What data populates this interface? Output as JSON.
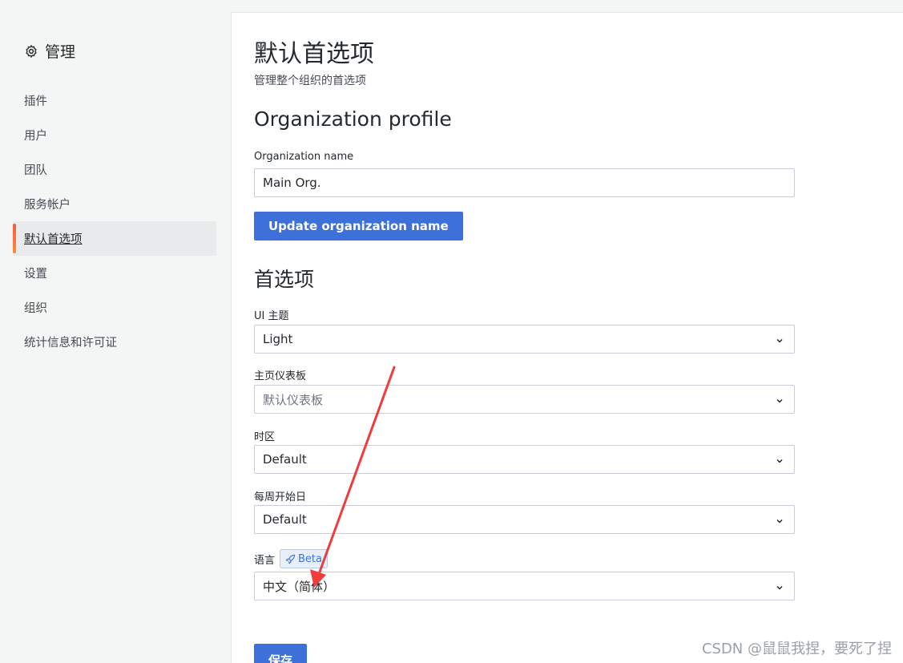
{
  "sidebar": {
    "title": "管理",
    "items": [
      {
        "label": "插件"
      },
      {
        "label": "用户"
      },
      {
        "label": "团队"
      },
      {
        "label": "服务帐户"
      },
      {
        "label": "默认首选项",
        "active": true
      },
      {
        "label": "设置"
      },
      {
        "label": "组织"
      },
      {
        "label": "统计信息和许可证"
      }
    ]
  },
  "header": {
    "title": "默认首选项",
    "subtitle": "管理整个组织的首选项"
  },
  "org_profile": {
    "section_title": "Organization profile",
    "name_label": "Organization name",
    "name_value": "Main Org.",
    "update_button": "Update organization name"
  },
  "preferences": {
    "section_title": "首选项",
    "ui_theme": {
      "label": "UI 主题",
      "value": "Light"
    },
    "home_dashboard": {
      "label": "主页仪表板",
      "placeholder": "默认仪表板"
    },
    "timezone": {
      "label": "时区",
      "value": "Default"
    },
    "week_start": {
      "label": "每周开始日",
      "value": "Default"
    },
    "language": {
      "label": "语言",
      "badge": "Beta",
      "value": "中文（简体）"
    },
    "save_button": "保存"
  },
  "watermark": "CSDN @鼠鼠我捏，要死了捏",
  "colors": {
    "primary": "#3d71d9",
    "active_indicator": "#f55f3e",
    "annotation_arrow": "#f03c3c"
  }
}
